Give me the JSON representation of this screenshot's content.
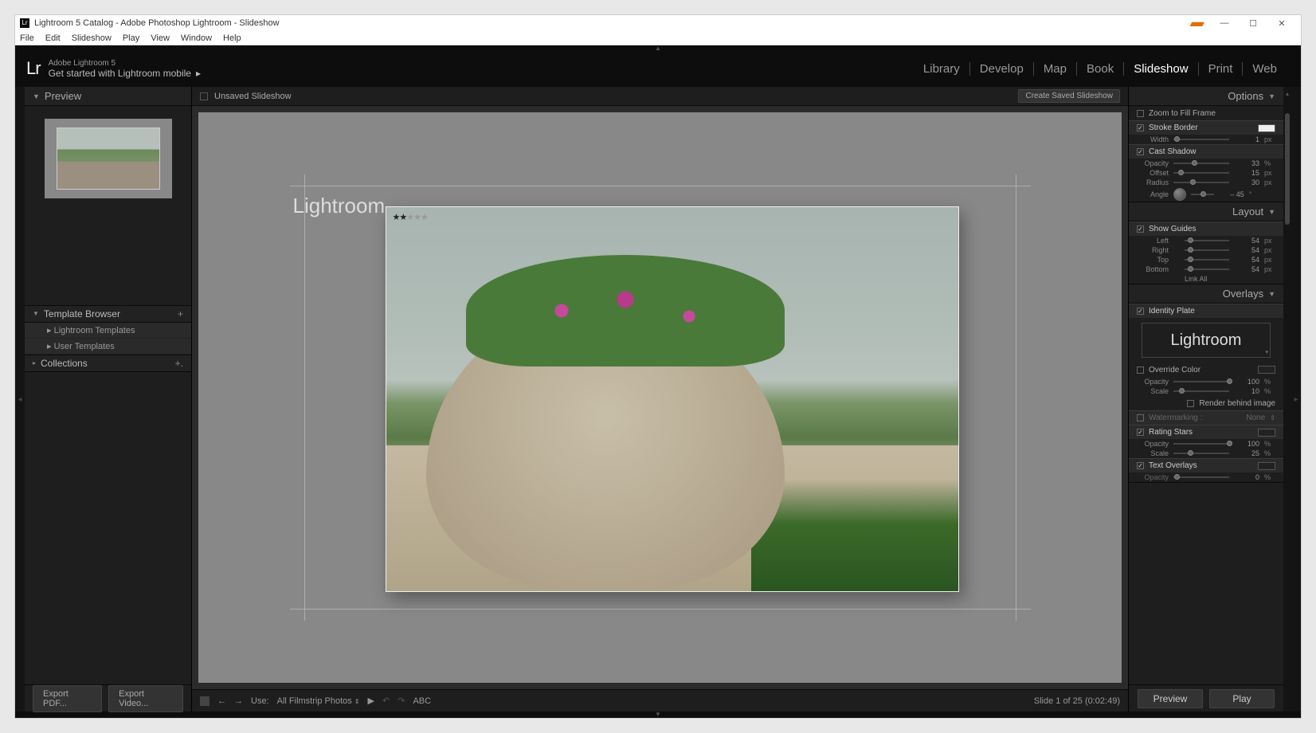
{
  "window": {
    "title": "Lightroom 5 Catalog - Adobe Photoshop Lightroom - Slideshow"
  },
  "menubar": [
    "File",
    "Edit",
    "Slideshow",
    "Play",
    "View",
    "Window",
    "Help"
  ],
  "header": {
    "logo": "Lr",
    "product": "Adobe Lightroom 5",
    "mobile_link": "Get started with Lightroom mobile"
  },
  "modules": [
    "Library",
    "Develop",
    "Map",
    "Book",
    "Slideshow",
    "Print",
    "Web"
  ],
  "active_module": "Slideshow",
  "left": {
    "preview_title": "Preview",
    "template_browser": "Template Browser",
    "templates": [
      "Lightroom Templates",
      "User Templates"
    ],
    "collections": "Collections"
  },
  "center": {
    "title": "Unsaved Slideshow",
    "save_btn": "Create Saved Slideshow",
    "identity_text": "Lightroom",
    "rating_stars": 2,
    "footer": {
      "use_label": "Use:",
      "use_value": "All Filmstrip Photos",
      "abc": "ABC",
      "status": "Slide 1 of 25 (0:02:49)"
    }
  },
  "bottom": {
    "export_pdf": "Export PDF...",
    "export_video": "Export Video...",
    "preview": "Preview",
    "play": "Play"
  },
  "right": {
    "options_title": "Options",
    "zoom_fill": "Zoom to Fill Frame",
    "stroke_border": "Stroke Border",
    "stroke_width_label": "Width",
    "stroke_width": "1",
    "cast_shadow": "Cast Shadow",
    "shadow_opacity_label": "Opacity",
    "shadow_opacity": "33",
    "shadow_offset_label": "Offset",
    "shadow_offset": "15",
    "shadow_radius_label": "Radius",
    "shadow_radius": "30",
    "shadow_angle_label": "Angle",
    "shadow_angle": "– 45",
    "layout_title": "Layout",
    "show_guides": "Show Guides",
    "left_label": "Left",
    "left_val": "54",
    "right_label": "Right",
    "right_val": "54",
    "top_label": "Top",
    "top_val": "54",
    "bottom_label": "Bottom",
    "bottom_val": "54",
    "link_all": "Link All",
    "overlays_title": "Overlays",
    "identity_plate": "Identity Plate",
    "identity_text": "Lightroom",
    "override_color": "Override Color",
    "id_opacity_label": "Opacity",
    "id_opacity": "100",
    "id_scale_label": "Scale",
    "id_scale": "10",
    "render_behind": "Render behind image",
    "watermarking": "Watermarking :",
    "watermarking_val": "None",
    "rating_stars_label": "Rating Stars",
    "rs_opacity_label": "Opacity",
    "rs_opacity": "100",
    "rs_scale_label": "Scale",
    "rs_scale": "25",
    "text_overlays": "Text Overlays",
    "to_opacity_label": "Opacity",
    "to_opacity": "0"
  },
  "units": {
    "px": "px",
    "pct": "%",
    "deg": "°"
  }
}
